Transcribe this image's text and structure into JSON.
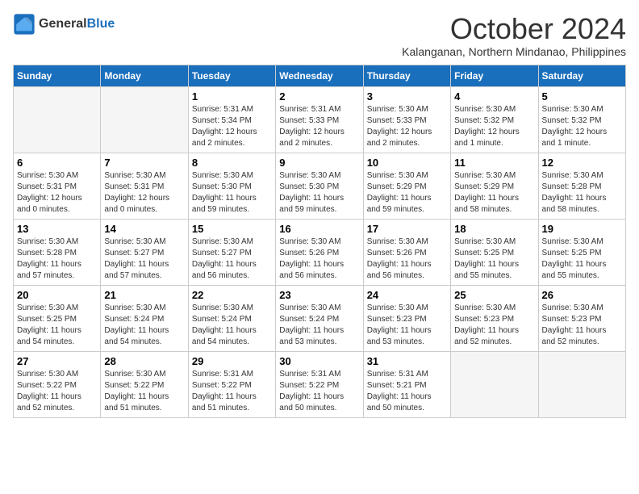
{
  "logo": {
    "line1": "General",
    "line2": "Blue"
  },
  "header": {
    "month": "October 2024",
    "location": "Kalanganan, Northern Mindanao, Philippines"
  },
  "weekdays": [
    "Sunday",
    "Monday",
    "Tuesday",
    "Wednesday",
    "Thursday",
    "Friday",
    "Saturday"
  ],
  "weeks": [
    [
      {
        "day": "",
        "detail": ""
      },
      {
        "day": "",
        "detail": ""
      },
      {
        "day": "1",
        "detail": "Sunrise: 5:31 AM\nSunset: 5:34 PM\nDaylight: 12 hours\nand 2 minutes."
      },
      {
        "day": "2",
        "detail": "Sunrise: 5:31 AM\nSunset: 5:33 PM\nDaylight: 12 hours\nand 2 minutes."
      },
      {
        "day": "3",
        "detail": "Sunrise: 5:30 AM\nSunset: 5:33 PM\nDaylight: 12 hours\nand 2 minutes."
      },
      {
        "day": "4",
        "detail": "Sunrise: 5:30 AM\nSunset: 5:32 PM\nDaylight: 12 hours\nand 1 minute."
      },
      {
        "day": "5",
        "detail": "Sunrise: 5:30 AM\nSunset: 5:32 PM\nDaylight: 12 hours\nand 1 minute."
      }
    ],
    [
      {
        "day": "6",
        "detail": "Sunrise: 5:30 AM\nSunset: 5:31 PM\nDaylight: 12 hours\nand 0 minutes."
      },
      {
        "day": "7",
        "detail": "Sunrise: 5:30 AM\nSunset: 5:31 PM\nDaylight: 12 hours\nand 0 minutes."
      },
      {
        "day": "8",
        "detail": "Sunrise: 5:30 AM\nSunset: 5:30 PM\nDaylight: 11 hours\nand 59 minutes."
      },
      {
        "day": "9",
        "detail": "Sunrise: 5:30 AM\nSunset: 5:30 PM\nDaylight: 11 hours\nand 59 minutes."
      },
      {
        "day": "10",
        "detail": "Sunrise: 5:30 AM\nSunset: 5:29 PM\nDaylight: 11 hours\nand 59 minutes."
      },
      {
        "day": "11",
        "detail": "Sunrise: 5:30 AM\nSunset: 5:29 PM\nDaylight: 11 hours\nand 58 minutes."
      },
      {
        "day": "12",
        "detail": "Sunrise: 5:30 AM\nSunset: 5:28 PM\nDaylight: 11 hours\nand 58 minutes."
      }
    ],
    [
      {
        "day": "13",
        "detail": "Sunrise: 5:30 AM\nSunset: 5:28 PM\nDaylight: 11 hours\nand 57 minutes."
      },
      {
        "day": "14",
        "detail": "Sunrise: 5:30 AM\nSunset: 5:27 PM\nDaylight: 11 hours\nand 57 minutes."
      },
      {
        "day": "15",
        "detail": "Sunrise: 5:30 AM\nSunset: 5:27 PM\nDaylight: 11 hours\nand 56 minutes."
      },
      {
        "day": "16",
        "detail": "Sunrise: 5:30 AM\nSunset: 5:26 PM\nDaylight: 11 hours\nand 56 minutes."
      },
      {
        "day": "17",
        "detail": "Sunrise: 5:30 AM\nSunset: 5:26 PM\nDaylight: 11 hours\nand 56 minutes."
      },
      {
        "day": "18",
        "detail": "Sunrise: 5:30 AM\nSunset: 5:25 PM\nDaylight: 11 hours\nand 55 minutes."
      },
      {
        "day": "19",
        "detail": "Sunrise: 5:30 AM\nSunset: 5:25 PM\nDaylight: 11 hours\nand 55 minutes."
      }
    ],
    [
      {
        "day": "20",
        "detail": "Sunrise: 5:30 AM\nSunset: 5:25 PM\nDaylight: 11 hours\nand 54 minutes."
      },
      {
        "day": "21",
        "detail": "Sunrise: 5:30 AM\nSunset: 5:24 PM\nDaylight: 11 hours\nand 54 minutes."
      },
      {
        "day": "22",
        "detail": "Sunrise: 5:30 AM\nSunset: 5:24 PM\nDaylight: 11 hours\nand 54 minutes."
      },
      {
        "day": "23",
        "detail": "Sunrise: 5:30 AM\nSunset: 5:24 PM\nDaylight: 11 hours\nand 53 minutes."
      },
      {
        "day": "24",
        "detail": "Sunrise: 5:30 AM\nSunset: 5:23 PM\nDaylight: 11 hours\nand 53 minutes."
      },
      {
        "day": "25",
        "detail": "Sunrise: 5:30 AM\nSunset: 5:23 PM\nDaylight: 11 hours\nand 52 minutes."
      },
      {
        "day": "26",
        "detail": "Sunrise: 5:30 AM\nSunset: 5:23 PM\nDaylight: 11 hours\nand 52 minutes."
      }
    ],
    [
      {
        "day": "27",
        "detail": "Sunrise: 5:30 AM\nSunset: 5:22 PM\nDaylight: 11 hours\nand 52 minutes."
      },
      {
        "day": "28",
        "detail": "Sunrise: 5:30 AM\nSunset: 5:22 PM\nDaylight: 11 hours\nand 51 minutes."
      },
      {
        "day": "29",
        "detail": "Sunrise: 5:31 AM\nSunset: 5:22 PM\nDaylight: 11 hours\nand 51 minutes."
      },
      {
        "day": "30",
        "detail": "Sunrise: 5:31 AM\nSunset: 5:22 PM\nDaylight: 11 hours\nand 50 minutes."
      },
      {
        "day": "31",
        "detail": "Sunrise: 5:31 AM\nSunset: 5:21 PM\nDaylight: 11 hours\nand 50 minutes."
      },
      {
        "day": "",
        "detail": ""
      },
      {
        "day": "",
        "detail": ""
      }
    ]
  ]
}
